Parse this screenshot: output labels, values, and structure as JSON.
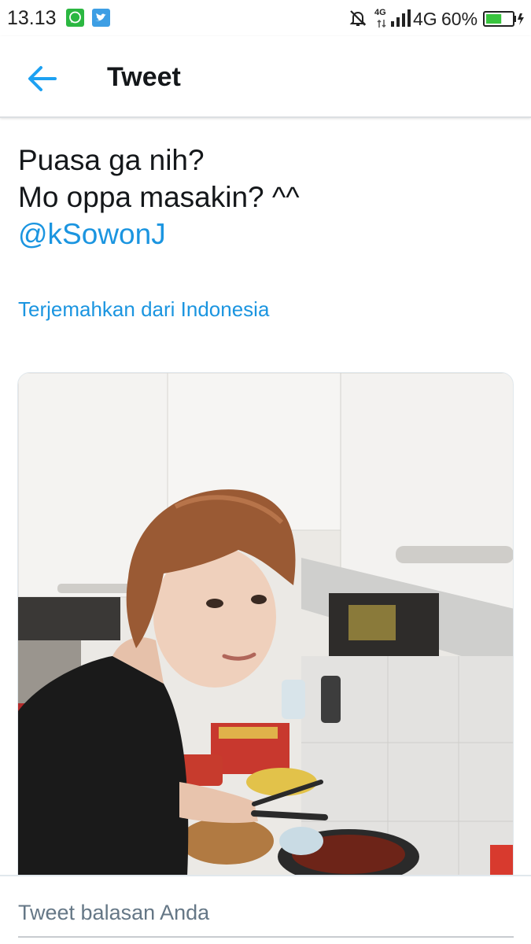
{
  "status_bar": {
    "time": "13.13",
    "network_small": "4G",
    "network": "4G",
    "battery_percent": "60%",
    "battery_level": 0.6,
    "icons": [
      "whatsapp-icon",
      "twitter-icon",
      "mute-bell-icon",
      "signal-icon",
      "battery-icon"
    ]
  },
  "app_bar": {
    "title": "Tweet",
    "back_icon": "arrow-left-icon"
  },
  "tweet": {
    "lines": [
      "Puasa ga nih?",
      "Mo oppa masakin? ^^"
    ],
    "mention": "@kSowonJ",
    "translate_link": "Terjemahkan dari Indonesia"
  },
  "reply": {
    "placeholder": "Tweet balasan Anda"
  },
  "colors": {
    "link": "#1b95e0",
    "back_arrow": "#1da1f2",
    "battery": "#39c43e"
  }
}
